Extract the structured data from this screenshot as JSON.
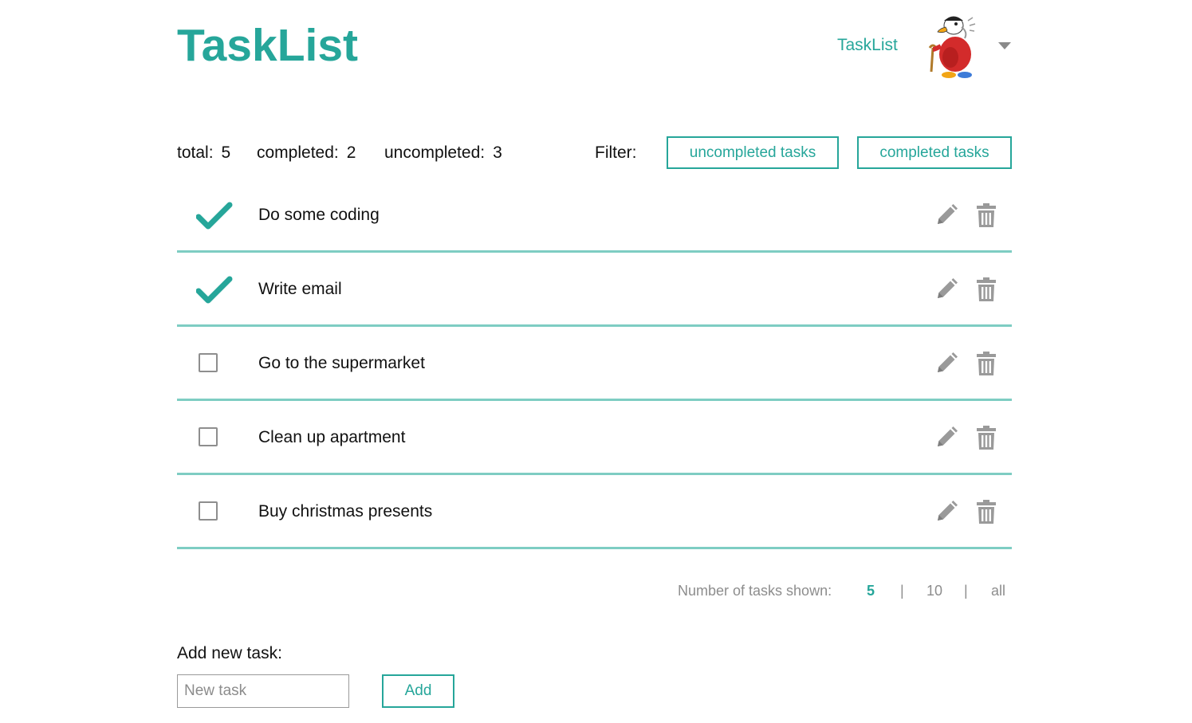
{
  "header": {
    "brand": "TaskList",
    "nav_link": "TaskList"
  },
  "stats": {
    "total_label": "total:",
    "total_value": "5",
    "completed_label": "completed:",
    "completed_value": "2",
    "uncompleted_label": "uncompleted:",
    "uncompleted_value": "3"
  },
  "filter": {
    "label": "Filter:",
    "uncompleted_button": "uncompleted tasks",
    "completed_button": "completed tasks"
  },
  "tasks": [
    {
      "text": "Do some coding",
      "completed": true
    },
    {
      "text": "Write email",
      "completed": true
    },
    {
      "text": "Go to the supermarket",
      "completed": false
    },
    {
      "text": "Clean up apartment",
      "completed": false
    },
    {
      "text": "Buy christmas presents",
      "completed": false
    }
  ],
  "pagination": {
    "label": "Number of tasks shown:",
    "options": [
      "5",
      "10",
      "all"
    ],
    "separator": "|",
    "selected": "5"
  },
  "add_task": {
    "label": "Add new task:",
    "input_value": "",
    "input_placeholder": "New task",
    "button": "Add"
  },
  "icons": {
    "check": "checkmark-icon",
    "unchecked": "checkbox-icon",
    "edit": "pencil-icon",
    "delete": "trash-icon",
    "menu": "caret-down-icon"
  },
  "colors": {
    "accent": "#26a69a",
    "divider": "#7ecdc3",
    "icon_gray": "#9a9a9a",
    "muted_text": "#8d8d8d"
  }
}
